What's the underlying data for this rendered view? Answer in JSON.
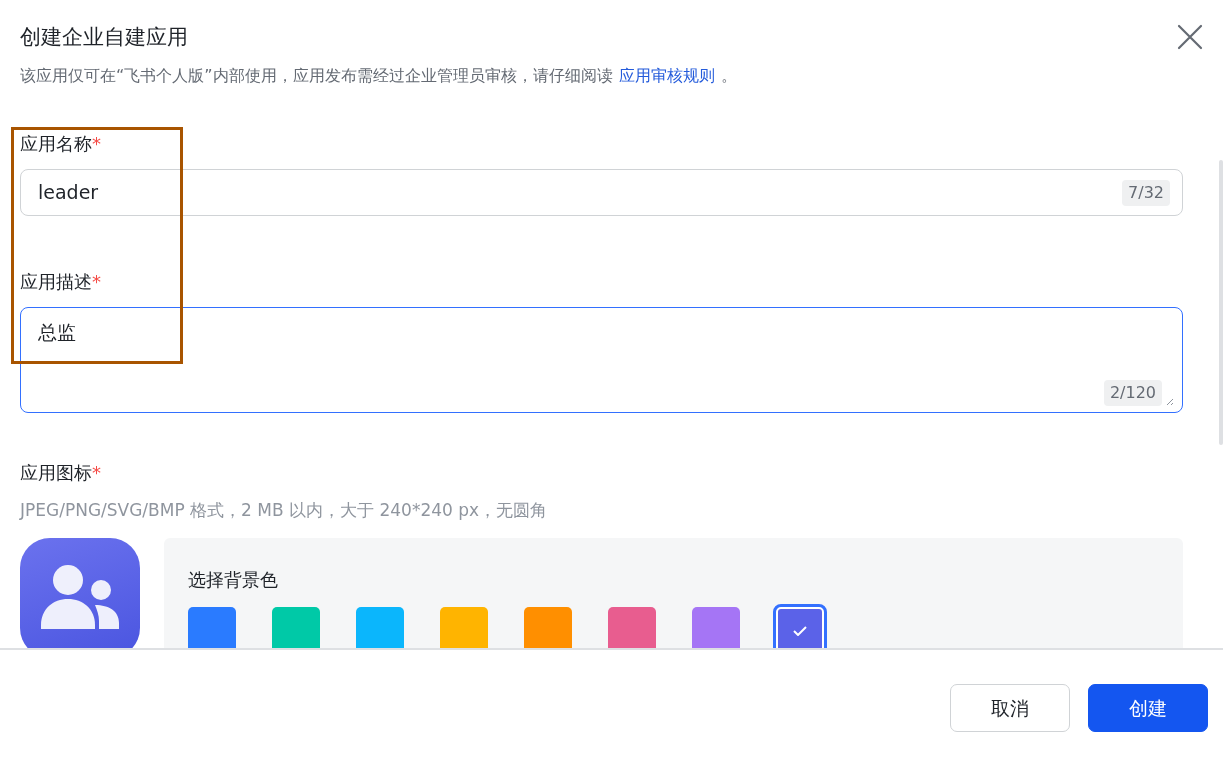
{
  "dialog": {
    "title": "创建企业自建应用",
    "notice": "该应用仅可在“飞书个人版”内部使用，应用发布需经过企业管理员审核，请仔细阅读",
    "notice_link": "应用审核规则",
    "notice_end": "。"
  },
  "fields": [
    {
      "kind": "input",
      "label": "应用名称",
      "required_mark": "*",
      "value": "leader",
      "counter": "7/32",
      "focused": false
    },
    {
      "kind": "textarea",
      "label": "应用描述",
      "required_mark": "*",
      "value": "总监",
      "counter": "2/120",
      "focused": true
    }
  ],
  "icon_section": {
    "label": "应用图标",
    "required_mark": "*",
    "hint": "JPEG/PNG/SVG/BMP 格式，2 MB 以内，大于 240*240 px，无圆角",
    "picker_title": "选择背景色",
    "swatches": [
      {
        "color": "#2a7bff",
        "selected": false
      },
      {
        "color": "#00c9a7",
        "selected": false
      },
      {
        "color": "#0bb6fc",
        "selected": false
      },
      {
        "color": "#ffb400",
        "selected": false
      },
      {
        "color": "#ff8f00",
        "selected": false
      },
      {
        "color": "#e85d8f",
        "selected": false
      },
      {
        "color": "#a575f5",
        "selected": false
      },
      {
        "color": "#5b62e8",
        "selected": true
      }
    ]
  },
  "footer": {
    "buttons": [
      {
        "label": "取消",
        "kind": "secondary"
      },
      {
        "label": "创建",
        "kind": "primary"
      }
    ]
  }
}
